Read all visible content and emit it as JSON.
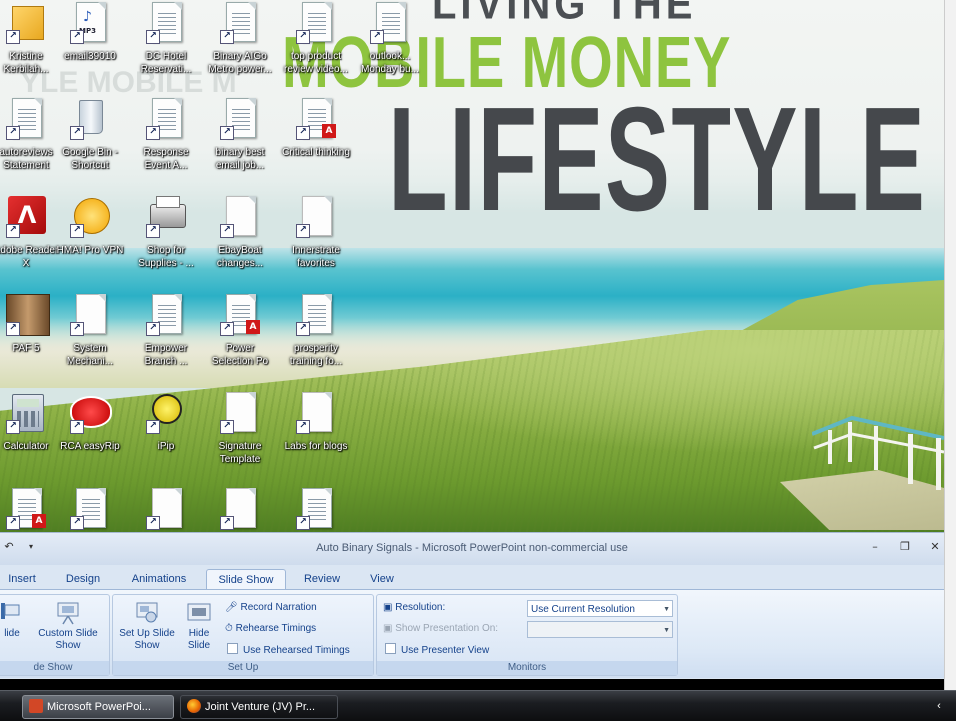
{
  "wallpaper": {
    "line1": "LIVING THE",
    "line2": "MOBILE MONEY",
    "line3": "LIFESTYLE",
    "faint_text": "YLE MOBILE M",
    "colors": {
      "green": "#8ec43f",
      "dark": "#45484c"
    }
  },
  "desktop_icons": [
    {
      "label": "Kristine Kerbilah...",
      "icon": "folder-icon"
    },
    {
      "label": "email39010",
      "icon": "mp3-file-icon",
      "badge": "MP3"
    },
    {
      "label": "DC Hotel Reservati...",
      "icon": "document-icon"
    },
    {
      "label": "Binary AIGo Metro power...",
      "icon": "document-icon"
    },
    {
      "label": "top product review video...",
      "icon": "document-icon"
    },
    {
      "label": "outlook... Monday bu...",
      "icon": "document-icon"
    },
    {
      "label": "autoreviews Statement",
      "icon": "document-icon"
    },
    {
      "label": "Google Bin - Shortcut",
      "icon": "recycle-bin-icon"
    },
    {
      "label": "Response Event A...",
      "icon": "document-icon"
    },
    {
      "label": "binary best email job...",
      "icon": "document-icon"
    },
    {
      "label": "Critical thinking",
      "icon": "pdf-icon"
    },
    {
      "label": "Adobe Reader X",
      "icon": "adobe-reader-icon"
    },
    {
      "label": "HMA! Pro VPN",
      "icon": "hma-vpn-icon"
    },
    {
      "label": "Shop for Supplies - ...",
      "icon": "printer-icon"
    },
    {
      "label": "EbayBoat changes...",
      "icon": "text-file-icon"
    },
    {
      "label": "Innerstrate favorites",
      "icon": "text-file-icon"
    },
    {
      "label": "PAF 5",
      "icon": "paf-family-icon"
    },
    {
      "label": "System Mechani...",
      "icon": "text-file-icon"
    },
    {
      "label": "Empower Branch ...",
      "icon": "document-icon"
    },
    {
      "label": "Power Selection Po",
      "icon": "pdf-icon"
    },
    {
      "label": "prosperity training fo...",
      "icon": "document-icon"
    },
    {
      "label": "Calculator",
      "icon": "calculator-icon"
    },
    {
      "label": "RCA easyRip",
      "icon": "rca-easyrip-icon"
    },
    {
      "label": "iPip",
      "icon": "ipip-icon"
    },
    {
      "label": "Signature Template",
      "icon": "text-file-icon"
    },
    {
      "label": "Labs for blogs",
      "icon": "text-file-icon"
    },
    {
      "label": "",
      "icon": "pdf-icon"
    },
    {
      "label": "",
      "icon": "document-icon"
    },
    {
      "label": "",
      "icon": "text-file-icon"
    },
    {
      "label": "",
      "icon": "text-file-icon"
    },
    {
      "label": "",
      "icon": "document-icon"
    }
  ],
  "powerpoint": {
    "title": "Auto Binary Signals - Microsoft PowerPoint non-commercial use",
    "tabs": [
      {
        "label": "Insert"
      },
      {
        "label": "Design"
      },
      {
        "label": "Animations"
      },
      {
        "label": "Slide Show",
        "active": true
      },
      {
        "label": "Review"
      },
      {
        "label": "View"
      }
    ],
    "groups": {
      "start": {
        "label": "de Show",
        "from_slide": "lide",
        "custom": "Custom Slide Show"
      },
      "setup": {
        "label": "Set Up",
        "setup_slide_show": "Set Up Slide Show",
        "hide_slide": "Hide Slide",
        "record_narration": "Record Narration",
        "rehearse_timings": "Rehearse Timings",
        "use_rehearsed_timings": "Use Rehearsed Timings"
      },
      "monitors": {
        "label": "Monitors",
        "resolution_label": "Resolution:",
        "resolution_value": "Use Current Resolution",
        "show_on_label": "Show Presentation On:",
        "show_on_value": "",
        "presenter_view": "Use Presenter View"
      }
    }
  },
  "taskbar": {
    "items": [
      {
        "label": "Microsoft PowerPoi...",
        "icon": "powerpoint-icon"
      },
      {
        "label": "Joint Venture (JV) Pr...",
        "icon": "firefox-icon"
      }
    ]
  }
}
